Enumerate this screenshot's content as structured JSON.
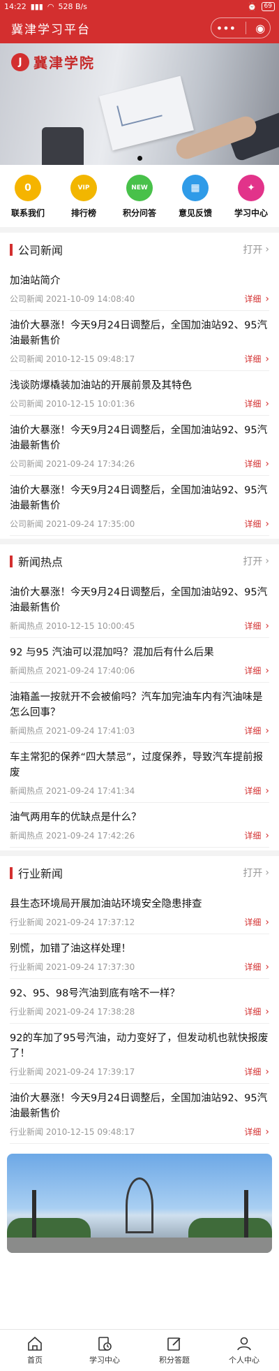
{
  "status": {
    "time": "14:22",
    "net": "528 B/s",
    "battery": "69"
  },
  "navbar": {
    "title": "冀津学习平台"
  },
  "banner": {
    "logo_text": "冀津学院"
  },
  "quicknav": [
    {
      "label": "联系我们",
      "color": "#f5b400",
      "icon": "contact-icon",
      "glyph": "0"
    },
    {
      "label": "排行榜",
      "color": "#f2b600",
      "icon": "vip-crown-icon",
      "glyph": "VIP"
    },
    {
      "label": "积分问答",
      "color": "#48c14a",
      "icon": "new-badge-icon",
      "glyph": "NEW"
    },
    {
      "label": "意见反馈",
      "color": "#2f9be8",
      "icon": "calendar-icon",
      "glyph": "▦"
    },
    {
      "label": "学习中心",
      "color": "#e2338a",
      "icon": "compass-icon",
      "glyph": "✦"
    }
  ],
  "labels": {
    "open": "打开",
    "detail": "详细"
  },
  "sections": [
    {
      "title": "公司新闻",
      "items": [
        {
          "title": "加油站简介",
          "meta": "公司新闻 2021-10-09 14:08:40"
        },
        {
          "title": "油价大暴涨！今天9月24日调整后，全国加油站92、95汽油最新售价",
          "meta": "公司新闻 2010-12-15 09:48:17"
        },
        {
          "title": "浅谈防爆橇装加油站的开展前景及其特色",
          "meta": "公司新闻 2010-12-15 10:01:36"
        },
        {
          "title": "油价大暴涨！今天9月24日调整后，全国加油站92、95汽油最新售价",
          "meta": "公司新闻 2021-09-24 17:34:26"
        },
        {
          "title": "油价大暴涨！今天9月24日调整后，全国加油站92、95汽油最新售价",
          "meta": "公司新闻 2021-09-24 17:35:00"
        }
      ]
    },
    {
      "title": "新闻热点",
      "items": [
        {
          "title": "油价大暴涨！今天9月24日调整后，全国加油站92、95汽油最新售价",
          "meta": "新闻热点 2010-12-15 10:00:45"
        },
        {
          "title": "92 与95 汽油可以混加吗？混加后有什么后果",
          "meta": "新闻热点 2021-09-24 17:40:06"
        },
        {
          "title": "油箱盖一按就开不会被偷吗？汽车加完油车内有汽油味是怎么回事？",
          "meta": "新闻热点 2021-09-24 17:41:03"
        },
        {
          "title": "车主常犯的保养“四大禁忌”，过度保养，导致汽车提前报废",
          "meta": "新闻热点 2021-09-24 17:41:34"
        },
        {
          "title": "油气两用车的优缺点是什么？",
          "meta": "新闻热点 2021-09-24 17:42:26"
        }
      ]
    },
    {
      "title": "行业新闻",
      "items": [
        {
          "title": "县生态环境局开展加油站环境安全隐患排查",
          "meta": "行业新闻 2021-09-24 17:37:12"
        },
        {
          "title": "别慌，加错了油这样处理！",
          "meta": "行业新闻 2021-09-24 17:37:30"
        },
        {
          "title": "92、95、98号汽油到底有啥不一样？",
          "meta": "行业新闻 2021-09-24 17:38:28"
        },
        {
          "title": "92的车加了95号汽油，动力变好了，但发动机也就快报废了！",
          "meta": "行业新闻 2021-09-24 17:39:17"
        },
        {
          "title": "油价大暴涨！今天9月24日调整后，全国加油站92、95汽油最新售价",
          "meta": "行业新闻 2010-12-15 09:48:17"
        }
      ]
    }
  ],
  "tabbar": [
    {
      "label": "首页",
      "icon": "home-icon"
    },
    {
      "label": "学习中心",
      "icon": "study-clock-icon"
    },
    {
      "label": "积分答题",
      "icon": "edit-icon"
    },
    {
      "label": "个人中心",
      "icon": "user-icon"
    }
  ],
  "colors": {
    "brand": "#d32f2f",
    "muted": "#999999"
  }
}
